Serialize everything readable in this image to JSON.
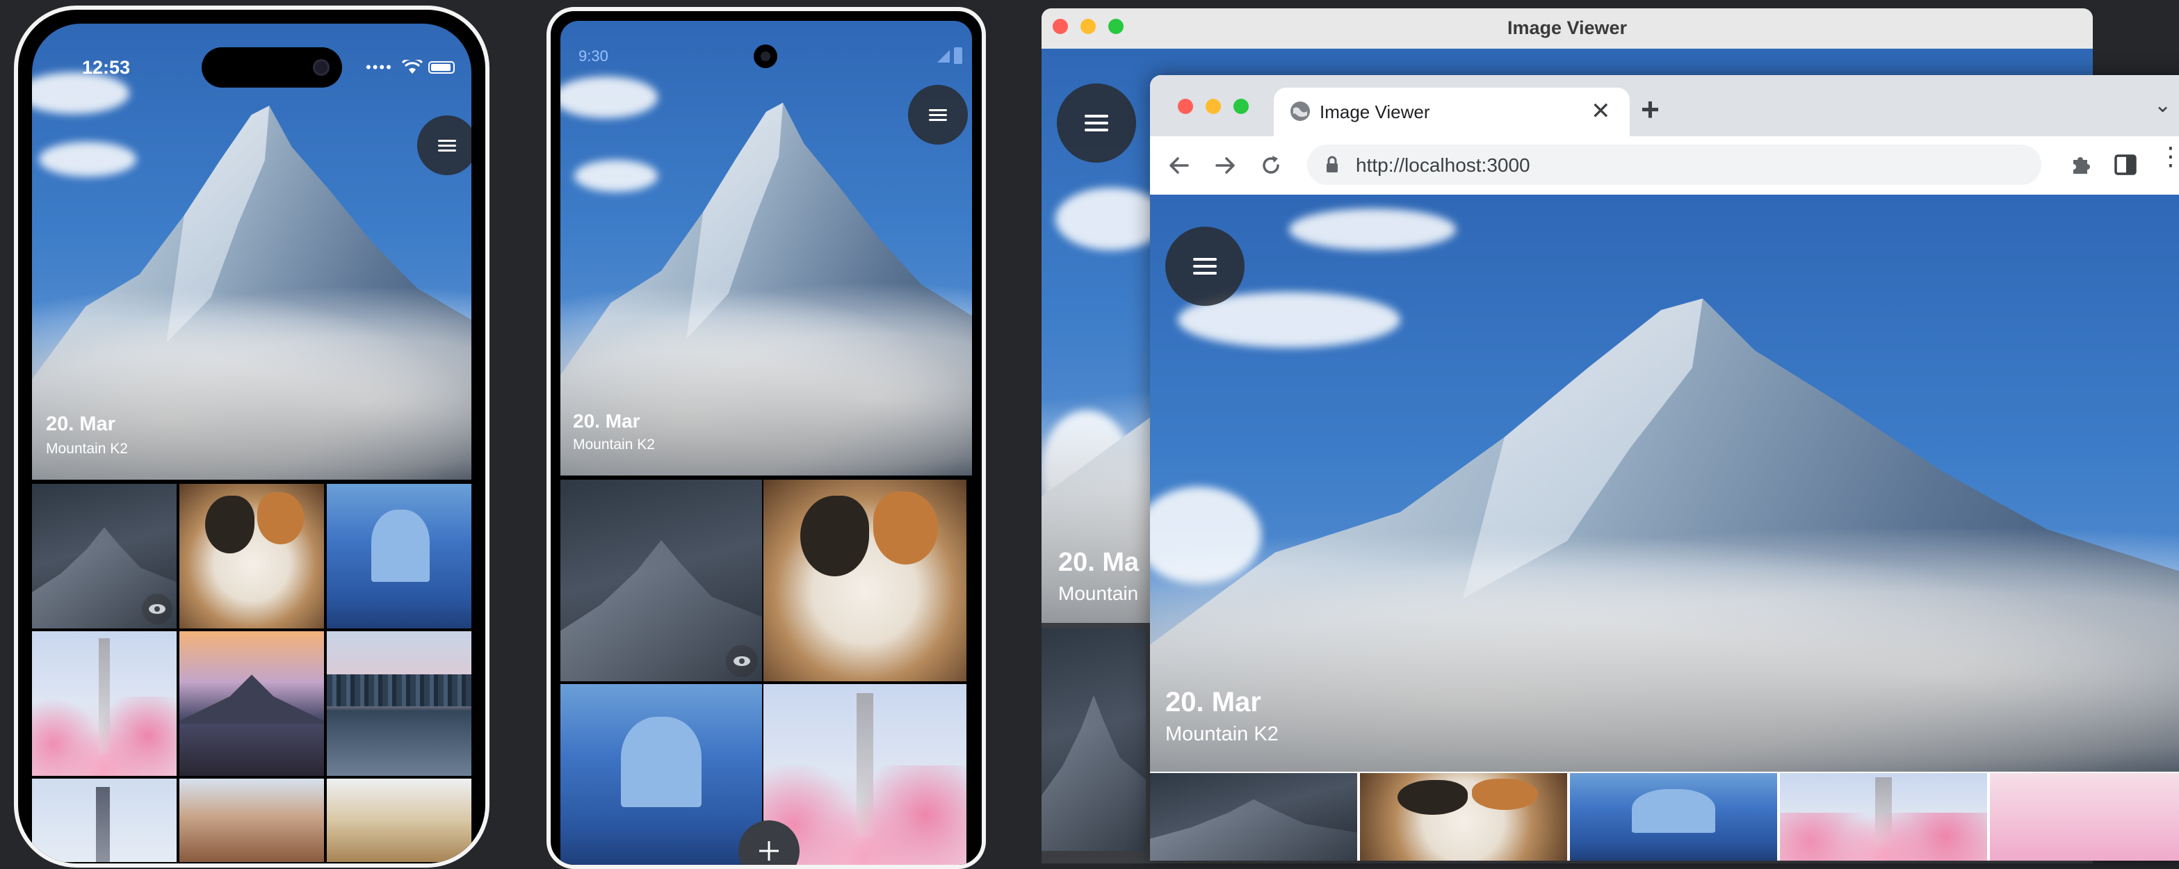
{
  "colors": {
    "background": "#25272b",
    "window_chrome": "#e8e8e8",
    "browser_tabstrip": "#dee1e6",
    "traffic_red": "#ff5f57",
    "traffic_yellow": "#febc2e",
    "traffic_green": "#28c840"
  },
  "phone_ios": {
    "status_time": "12:53",
    "hero": {
      "date": "20. Mar",
      "title": "Mountain K2"
    }
  },
  "phone_android": {
    "status_time": "9:30",
    "hero": {
      "date": "20. Mar",
      "title": "Mountain K2"
    }
  },
  "desktop_window": {
    "title": "Image Viewer",
    "hero_partial": {
      "date": "20. Ma",
      "title": "Mountain"
    }
  },
  "browser": {
    "tab_title": "Image Viewer",
    "url": "http://localhost:3000",
    "hero": {
      "date": "20. Mar",
      "title": "Mountain K2"
    }
  },
  "icons": {
    "menu": "hamburger-icon",
    "view": "eye-icon",
    "add": "plus-icon",
    "back": "arrow-left-icon",
    "forward": "arrow-right-icon",
    "reload": "reload-icon",
    "lock": "lock-icon",
    "extensions": "puzzle-icon",
    "side_panel": "side-panel-icon",
    "more": "kebab-icon",
    "new_tab": "plus-icon",
    "close_tab": "close-icon",
    "tab_list": "chevron-down-icon",
    "globe": "globe-icon"
  }
}
